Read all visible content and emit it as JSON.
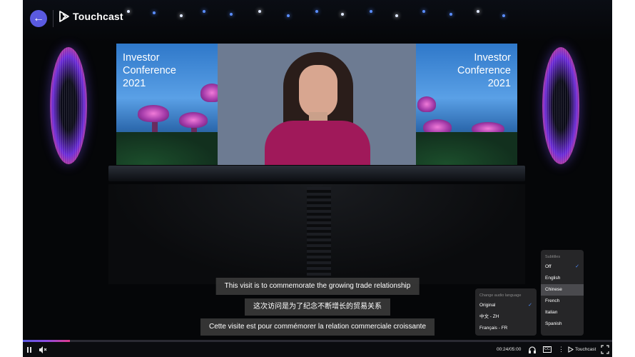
{
  "header": {
    "back_icon": "arrow-left-icon",
    "brand_name": "Touchcast",
    "accent_color": "#5a5ae0"
  },
  "screen": {
    "left_title": [
      "Investor",
      "Conference",
      "2021"
    ],
    "right_title": [
      "Investor",
      "Conference",
      "2021"
    ]
  },
  "subtitles": {
    "english": "This visit is to commemorate the growing trade relationship",
    "chinese": "这次访问是为了纪念不断增长的贸易关系",
    "french": "Cette visite est pour commémorer la relation commerciale croissante"
  },
  "audio_menu": {
    "header": "Change audio language",
    "items": [
      "Original",
      "中文 - ZH",
      "Français - FR"
    ],
    "selected": "Original"
  },
  "subtitle_menu": {
    "header": "Subtitles",
    "items": [
      "Off",
      "English",
      "Chinese",
      "French",
      "Italian",
      "Spanish"
    ],
    "selected": "Off",
    "highlighted": "Chinese"
  },
  "controls": {
    "time": "00:24/05:00",
    "progress": 0.08,
    "cc_label": "CC",
    "brand_name": "Touchcast",
    "icons": [
      "pause-icon",
      "volume-icon",
      "headphones-icon",
      "closed-captions-icon",
      "more-vertical-icon",
      "fullscreen-icon"
    ]
  }
}
